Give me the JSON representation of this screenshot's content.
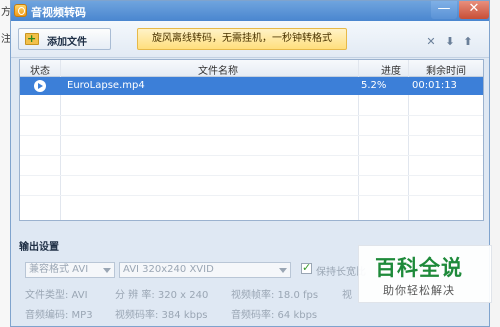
{
  "window": {
    "title": "音视频转码",
    "min_label": "—",
    "close_label": "✕"
  },
  "background": {
    "left_text_1": "方",
    "left_text_2": "注"
  },
  "toolbar": {
    "add_file_label": "添加文件",
    "banner_text": "旋风离线转码，无需挂机，一秒钟转格式",
    "delete_icon": "✕",
    "move_down_icon": "⬇",
    "move_up_icon": "⬆"
  },
  "table": {
    "headers": {
      "status": "状态",
      "filename": "文件名称",
      "progress": "进度",
      "remaining": "剩余时间"
    },
    "rows": [
      {
        "status_icon": "arrow-right-circle-icon",
        "filename": "EuroLapse.mp4",
        "progress": "5.2%",
        "remaining": "00:01:13"
      }
    ]
  },
  "output": {
    "title": "输出设置",
    "format_select": "兼容格式 AVI",
    "preset_select": "AVI 320x240 XVID",
    "keep_ratio_label": "保持长宽比",
    "keep_ratio_checked": true,
    "file_type": "文件类型: AVI",
    "resolution": "分 辨 率:  320 x 240",
    "video_fps": "视频帧率:  18.0 fps",
    "fragment_1": "视",
    "audio_codec": "音频编码: MP3",
    "video_bitrate": "视频码率:  384 kbps",
    "audio_bitrate": "音频码率:  64 kbps"
  },
  "watermark": {
    "title": "百科全说",
    "subtitle": "助你轻松解决"
  }
}
